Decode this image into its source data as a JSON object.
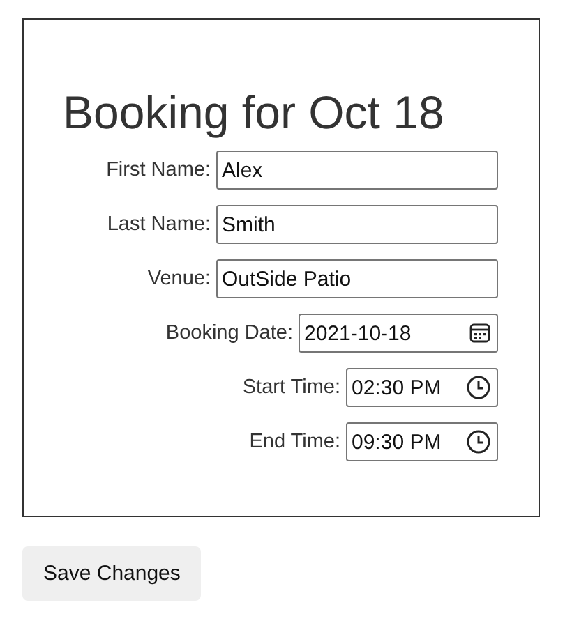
{
  "title": "Booking for Oct 18",
  "fields": [
    {
      "label": "First Name:",
      "value": "Alex",
      "kind": "text"
    },
    {
      "label": "Last Name:",
      "value": "Smith",
      "kind": "text"
    },
    {
      "label": "Venue:",
      "value": "OutSide Patio",
      "kind": "text"
    },
    {
      "label": "Booking Date:",
      "value": "2021-10-18",
      "kind": "date"
    },
    {
      "label": "Start Time:",
      "value": "02:30 PM",
      "kind": "time"
    },
    {
      "label": "End Time:",
      "value": "09:30 PM",
      "kind": "time"
    }
  ],
  "buttons": [
    "Save Changes"
  ]
}
